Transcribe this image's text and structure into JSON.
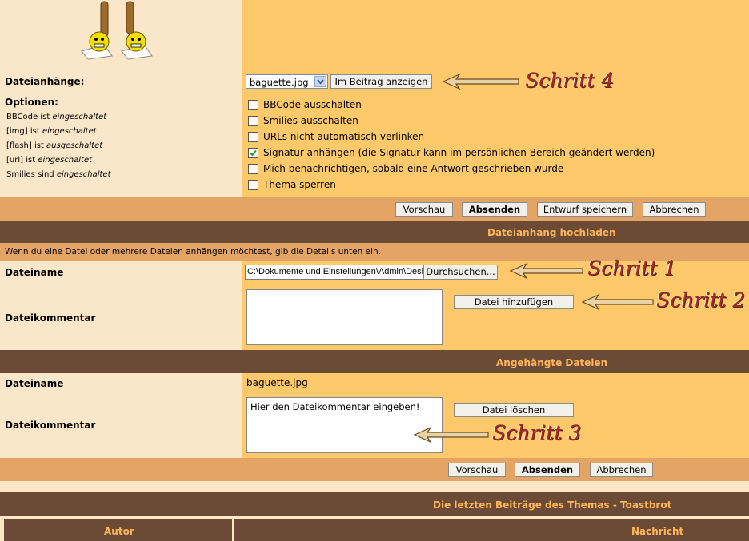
{
  "attachments_row": {
    "label": "Dateianhänge:",
    "select_value": "baguette.jpg",
    "show_button": "Im Beitrag anzeigen",
    "annotation": "Schritt 4"
  },
  "options": {
    "heading": "Optionen:",
    "status_lines": [
      {
        "prefix": "BBCode ist ",
        "state": "eingeschaltet"
      },
      {
        "prefix": "[img] ist ",
        "state": "eingeschaltet"
      },
      {
        "prefix": "[flash] ist ",
        "state": "ausgeschaltet"
      },
      {
        "prefix": "[url] ist ",
        "state": "eingeschaltet"
      },
      {
        "prefix": "Smilies sind ",
        "state": "eingeschaltet"
      }
    ],
    "checkboxes": [
      {
        "label": "BBCode ausschalten",
        "checked": false
      },
      {
        "label": "Smilies ausschalten",
        "checked": false
      },
      {
        "label": "URLs nicht automatisch verlinken",
        "checked": false
      },
      {
        "label": "Signatur anhängen (die Signatur kann im persönlichen Bereich geändert werden)",
        "checked": true
      },
      {
        "label": "Mich benachrichtigen, sobald eine Antwort geschrieben wurde",
        "checked": false
      },
      {
        "label": "Thema sperren",
        "checked": false
      }
    ]
  },
  "actions1": {
    "preview": "Vorschau",
    "submit": "Absenden",
    "save_draft": "Entwurf speichern",
    "cancel": "Abbrechen"
  },
  "upload": {
    "header": "Dateianhang hochladen",
    "info": "Wenn du eine Datei oder mehrere Dateien anhängen möchtest, gib die Details unten ein.",
    "filename_label": "Dateiname",
    "file_path": "C:\\Dokumente und Einstellungen\\Admin\\Desktop\\baguette.jpg",
    "browse": "Durchsuchen...",
    "annotation1": "Schritt 1",
    "comment_label": "Dateikommentar",
    "comment_value": "",
    "add_file": "Datei hinzufügen",
    "annotation2": "Schritt 2"
  },
  "attached": {
    "header": "Angehängte Dateien",
    "filename_label": "Dateiname",
    "filename_value": "baguette.jpg",
    "comment_label": "Dateikommentar",
    "comment_value": "Hier den Dateikommentar eingeben!",
    "delete_file": "Datei löschen",
    "annotation3": "Schritt 3"
  },
  "actions2": {
    "preview": "Vorschau",
    "submit": "Absenden",
    "cancel": "Abbrechen"
  },
  "recent": {
    "header": "Die letzten Beiträge des Themas - Toastbrot",
    "col_author": "Autor",
    "col_message": "Nachricht"
  }
}
